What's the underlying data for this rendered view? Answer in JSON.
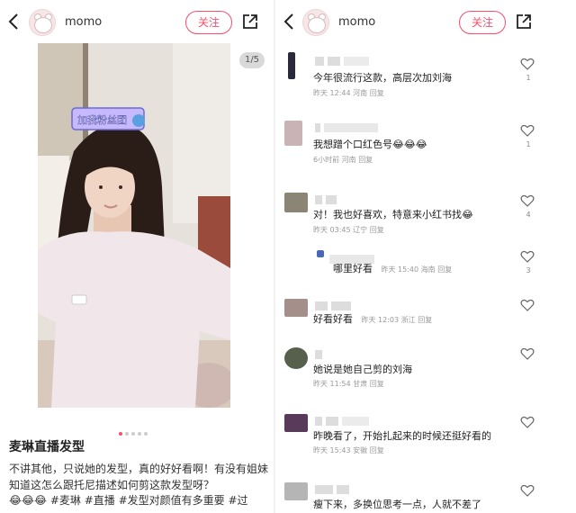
{
  "left": {
    "header": {
      "username": "momo",
      "follow_label": "关注"
    },
    "page_indicator": "1/5",
    "photo_sticker": "加我粉丝团",
    "post": {
      "title": "麦琳直播发型",
      "body": "不讲其他，只说她的发型，真的好好看啊！有没有姐妹知道这怎么跟托尼描述如何剪这款发型呀？",
      "tags": "😂😂😂 #麦琳 #直播 #发型对颜值有多重要 #过"
    }
  },
  "right": {
    "header": {
      "username": "momo",
      "follow_label": "关注"
    },
    "comments": [
      {
        "text": "今年很流行这款，高层次加刘海",
        "time": "昨天 12:44",
        "location": "河南",
        "reply": "回复",
        "likes": "1",
        "avatar_color": "#2a2a3a"
      },
      {
        "text": "我想蹭个口红色号😂😂😂",
        "time": "6小时前",
        "location": "河南",
        "reply": "回复",
        "likes": "1",
        "avatar_color": "#c8b4b4"
      },
      {
        "text": "对！我也好喜欢，特意来小红书找😂",
        "time": "昨天 03:45",
        "location": "辽宁",
        "reply": "回复",
        "likes": "4",
        "avatar_color": "#8a8575"
      },
      {
        "text": "哪里好看",
        "time": "昨天 15:40",
        "location": "海南",
        "reply": "回复",
        "likes": "3",
        "avatar_color": "#4a68b8",
        "is_reply": true
      },
      {
        "text": "好看好看",
        "time": "昨天 12:03",
        "location": "浙江",
        "reply": "回复",
        "likes": "",
        "avatar_color": "#a58f8a"
      },
      {
        "text": "她说是她自己剪的刘海",
        "time": "昨天 11:54",
        "location": "甘肃",
        "reply": "回复",
        "likes": "",
        "avatar_color": "#56604d"
      },
      {
        "text": "昨晚看了，开始扎起来的时候还挺好看的",
        "time": "昨天 15:43",
        "location": "安徽",
        "reply": "回复",
        "likes": "",
        "avatar_color": "#5a3a5a"
      },
      {
        "text": "瘦下来，多换位思考一点，人就不差了",
        "time": "",
        "location": "",
        "reply": "",
        "likes": "",
        "avatar_color": "#b5b5b5"
      }
    ]
  },
  "colors": {
    "accent": "#ff4d6a",
    "meta": "#999999",
    "text": "#222222"
  },
  "icons": [
    "back-icon",
    "share-icon",
    "heart-icon"
  ]
}
